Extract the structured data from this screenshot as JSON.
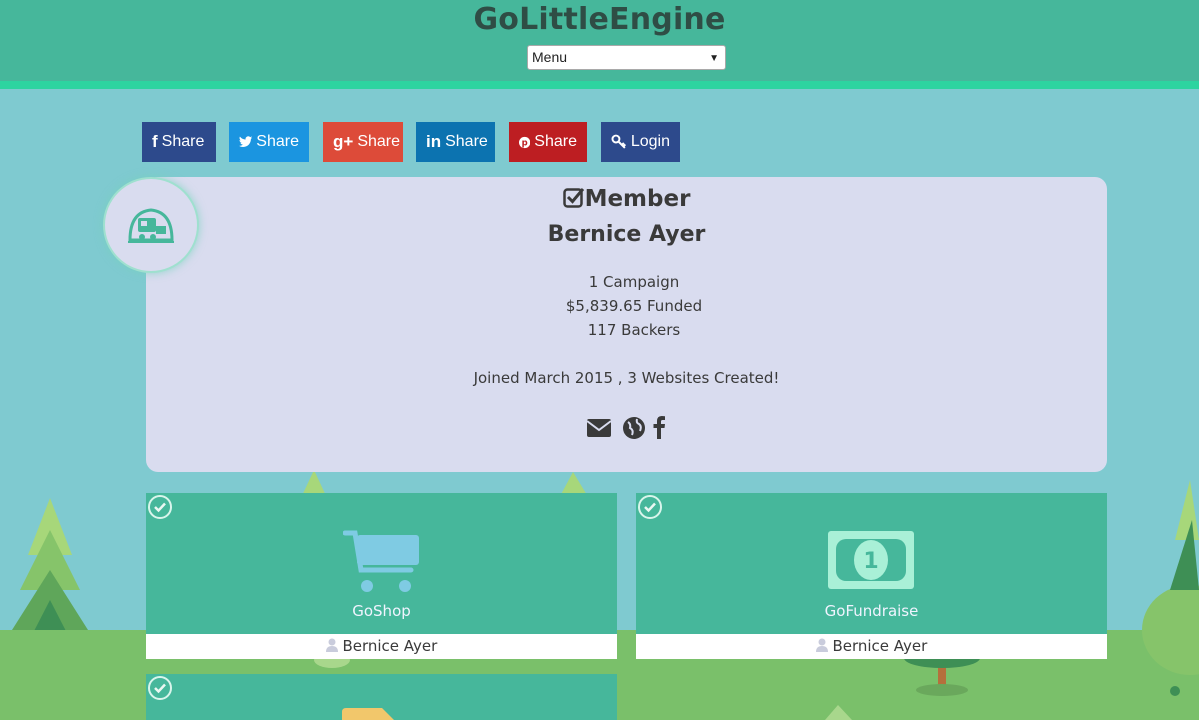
{
  "header": {
    "brand": "GoLittleEngine",
    "menu": {
      "selected": "Menu"
    }
  },
  "share_bar": {
    "buttons": [
      {
        "id": "facebook",
        "icon": "facebook-icon",
        "label": "Share",
        "color": "#2d4a8c"
      },
      {
        "id": "twitter",
        "icon": "twitter-icon",
        "label": "Share",
        "color": "#1b95e0"
      },
      {
        "id": "googleplus",
        "icon": "google-plus-icon",
        "label": "Share",
        "color": "#dd4b39"
      },
      {
        "id": "linkedin",
        "icon": "linkedin-icon",
        "label": "Share",
        "color": "#0c73b0"
      },
      {
        "id": "pinterest",
        "icon": "pinterest-icon",
        "label": "Share",
        "color": "#bd1e22"
      },
      {
        "id": "login",
        "icon": "key-icon",
        "label": "Login",
        "color": "#2d4a8c"
      }
    ]
  },
  "profile": {
    "badge": "Member",
    "name": "Bernice Ayer",
    "campaigns": "1 Campaign",
    "funded": "$5,839.65 Funded",
    "backers": "117 Backers",
    "joined": "Joined March 2015 , 3 Websites Created!",
    "contact_icons": [
      "envelope-icon",
      "globe-icon",
      "facebook-icon"
    ]
  },
  "tiles": [
    {
      "label": "GoShop",
      "icon": "shopping-cart-icon",
      "owner": "Bernice Ayer"
    },
    {
      "label": "GoFundraise",
      "icon": "money-bill-icon",
      "owner": "Bernice Ayer"
    },
    {
      "label": "",
      "icon": "tag-icon",
      "owner": ""
    }
  ],
  "colors": {
    "header": "#46b79b",
    "accent_stripe": "#2dd4a0",
    "page_bg": "#7fcad0",
    "card_bg": "#d9dcef",
    "tile_bg": "#46b79b"
  }
}
